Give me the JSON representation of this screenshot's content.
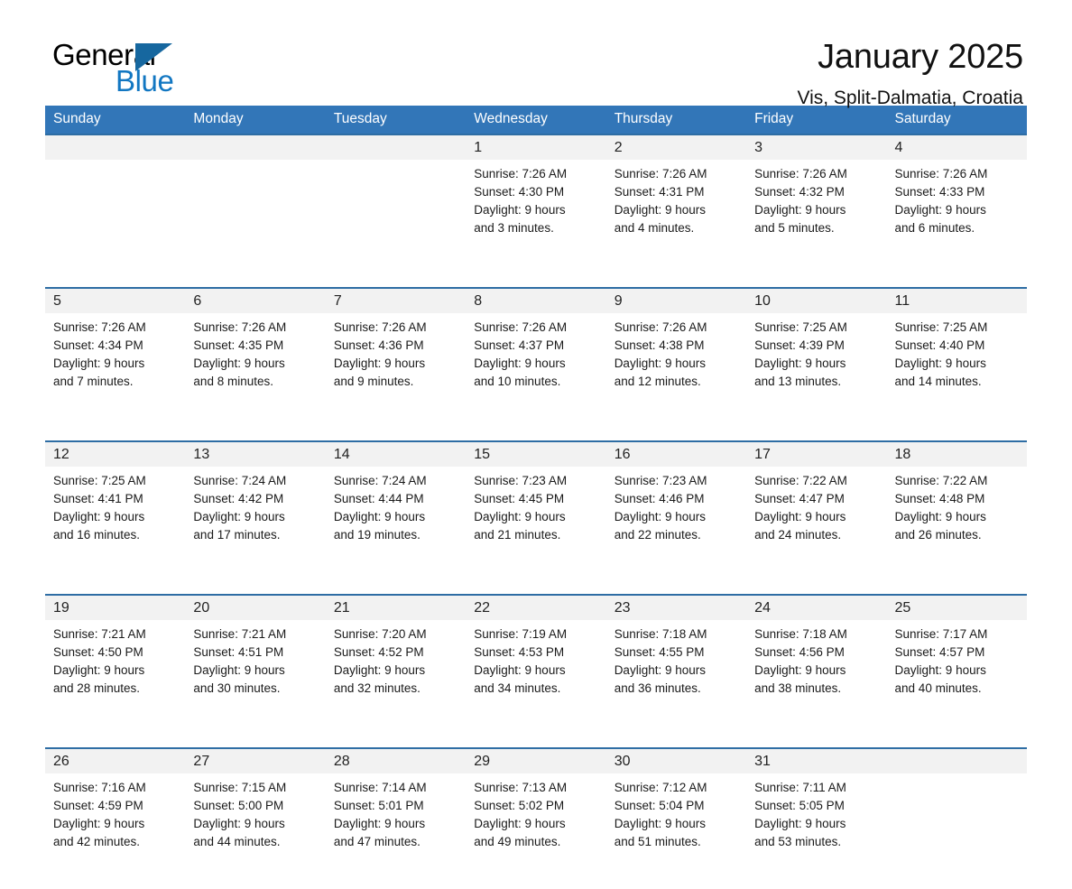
{
  "logo": {
    "word_one": "General",
    "word_two": "Blue",
    "triangle": "blue-triangle-icon"
  },
  "header": {
    "title": "January 2025",
    "subtitle": "Vis, Split-Dalmatia, Croatia"
  },
  "colors": {
    "header_blue": "#3276b8",
    "row_divider_blue": "#2e6da4",
    "day_number_band": "#f2f2f2",
    "logo_blue": "#1277c2",
    "text": "#1a1a1a"
  },
  "weekday_headers": [
    "Sunday",
    "Monday",
    "Tuesday",
    "Wednesday",
    "Thursday",
    "Friday",
    "Saturday"
  ],
  "weeks": [
    {
      "days": [
        {
          "number": "",
          "lines": []
        },
        {
          "number": "",
          "lines": []
        },
        {
          "number": "",
          "lines": []
        },
        {
          "number": "1",
          "lines": [
            "Sunrise: 7:26 AM",
            "Sunset: 4:30 PM",
            "Daylight: 9 hours",
            "and 3 minutes."
          ]
        },
        {
          "number": "2",
          "lines": [
            "Sunrise: 7:26 AM",
            "Sunset: 4:31 PM",
            "Daylight: 9 hours",
            "and 4 minutes."
          ]
        },
        {
          "number": "3",
          "lines": [
            "Sunrise: 7:26 AM",
            "Sunset: 4:32 PM",
            "Daylight: 9 hours",
            "and 5 minutes."
          ]
        },
        {
          "number": "4",
          "lines": [
            "Sunrise: 7:26 AM",
            "Sunset: 4:33 PM",
            "Daylight: 9 hours",
            "and 6 minutes."
          ]
        }
      ]
    },
    {
      "days": [
        {
          "number": "5",
          "lines": [
            "Sunrise: 7:26 AM",
            "Sunset: 4:34 PM",
            "Daylight: 9 hours",
            "and 7 minutes."
          ]
        },
        {
          "number": "6",
          "lines": [
            "Sunrise: 7:26 AM",
            "Sunset: 4:35 PM",
            "Daylight: 9 hours",
            "and 8 minutes."
          ]
        },
        {
          "number": "7",
          "lines": [
            "Sunrise: 7:26 AM",
            "Sunset: 4:36 PM",
            "Daylight: 9 hours",
            "and 9 minutes."
          ]
        },
        {
          "number": "8",
          "lines": [
            "Sunrise: 7:26 AM",
            "Sunset: 4:37 PM",
            "Daylight: 9 hours",
            "and 10 minutes."
          ]
        },
        {
          "number": "9",
          "lines": [
            "Sunrise: 7:26 AM",
            "Sunset: 4:38 PM",
            "Daylight: 9 hours",
            "and 12 minutes."
          ]
        },
        {
          "number": "10",
          "lines": [
            "Sunrise: 7:25 AM",
            "Sunset: 4:39 PM",
            "Daylight: 9 hours",
            "and 13 minutes."
          ]
        },
        {
          "number": "11",
          "lines": [
            "Sunrise: 7:25 AM",
            "Sunset: 4:40 PM",
            "Daylight: 9 hours",
            "and 14 minutes."
          ]
        }
      ]
    },
    {
      "days": [
        {
          "number": "12",
          "lines": [
            "Sunrise: 7:25 AM",
            "Sunset: 4:41 PM",
            "Daylight: 9 hours",
            "and 16 minutes."
          ]
        },
        {
          "number": "13",
          "lines": [
            "Sunrise: 7:24 AM",
            "Sunset: 4:42 PM",
            "Daylight: 9 hours",
            "and 17 minutes."
          ]
        },
        {
          "number": "14",
          "lines": [
            "Sunrise: 7:24 AM",
            "Sunset: 4:44 PM",
            "Daylight: 9 hours",
            "and 19 minutes."
          ]
        },
        {
          "number": "15",
          "lines": [
            "Sunrise: 7:23 AM",
            "Sunset: 4:45 PM",
            "Daylight: 9 hours",
            "and 21 minutes."
          ]
        },
        {
          "number": "16",
          "lines": [
            "Sunrise: 7:23 AM",
            "Sunset: 4:46 PM",
            "Daylight: 9 hours",
            "and 22 minutes."
          ]
        },
        {
          "number": "17",
          "lines": [
            "Sunrise: 7:22 AM",
            "Sunset: 4:47 PM",
            "Daylight: 9 hours",
            "and 24 minutes."
          ]
        },
        {
          "number": "18",
          "lines": [
            "Sunrise: 7:22 AM",
            "Sunset: 4:48 PM",
            "Daylight: 9 hours",
            "and 26 minutes."
          ]
        }
      ]
    },
    {
      "days": [
        {
          "number": "19",
          "lines": [
            "Sunrise: 7:21 AM",
            "Sunset: 4:50 PM",
            "Daylight: 9 hours",
            "and 28 minutes."
          ]
        },
        {
          "number": "20",
          "lines": [
            "Sunrise: 7:21 AM",
            "Sunset: 4:51 PM",
            "Daylight: 9 hours",
            "and 30 minutes."
          ]
        },
        {
          "number": "21",
          "lines": [
            "Sunrise: 7:20 AM",
            "Sunset: 4:52 PM",
            "Daylight: 9 hours",
            "and 32 minutes."
          ]
        },
        {
          "number": "22",
          "lines": [
            "Sunrise: 7:19 AM",
            "Sunset: 4:53 PM",
            "Daylight: 9 hours",
            "and 34 minutes."
          ]
        },
        {
          "number": "23",
          "lines": [
            "Sunrise: 7:18 AM",
            "Sunset: 4:55 PM",
            "Daylight: 9 hours",
            "and 36 minutes."
          ]
        },
        {
          "number": "24",
          "lines": [
            "Sunrise: 7:18 AM",
            "Sunset: 4:56 PM",
            "Daylight: 9 hours",
            "and 38 minutes."
          ]
        },
        {
          "number": "25",
          "lines": [
            "Sunrise: 7:17 AM",
            "Sunset: 4:57 PM",
            "Daylight: 9 hours",
            "and 40 minutes."
          ]
        }
      ]
    },
    {
      "days": [
        {
          "number": "26",
          "lines": [
            "Sunrise: 7:16 AM",
            "Sunset: 4:59 PM",
            "Daylight: 9 hours",
            "and 42 minutes."
          ]
        },
        {
          "number": "27",
          "lines": [
            "Sunrise: 7:15 AM",
            "Sunset: 5:00 PM",
            "Daylight: 9 hours",
            "and 44 minutes."
          ]
        },
        {
          "number": "28",
          "lines": [
            "Sunrise: 7:14 AM",
            "Sunset: 5:01 PM",
            "Daylight: 9 hours",
            "and 47 minutes."
          ]
        },
        {
          "number": "29",
          "lines": [
            "Sunrise: 7:13 AM",
            "Sunset: 5:02 PM",
            "Daylight: 9 hours",
            "and 49 minutes."
          ]
        },
        {
          "number": "30",
          "lines": [
            "Sunrise: 7:12 AM",
            "Sunset: 5:04 PM",
            "Daylight: 9 hours",
            "and 51 minutes."
          ]
        },
        {
          "number": "31",
          "lines": [
            "Sunrise: 7:11 AM",
            "Sunset: 5:05 PM",
            "Daylight: 9 hours",
            "and 53 minutes."
          ]
        },
        {
          "number": "",
          "lines": []
        }
      ]
    }
  ]
}
